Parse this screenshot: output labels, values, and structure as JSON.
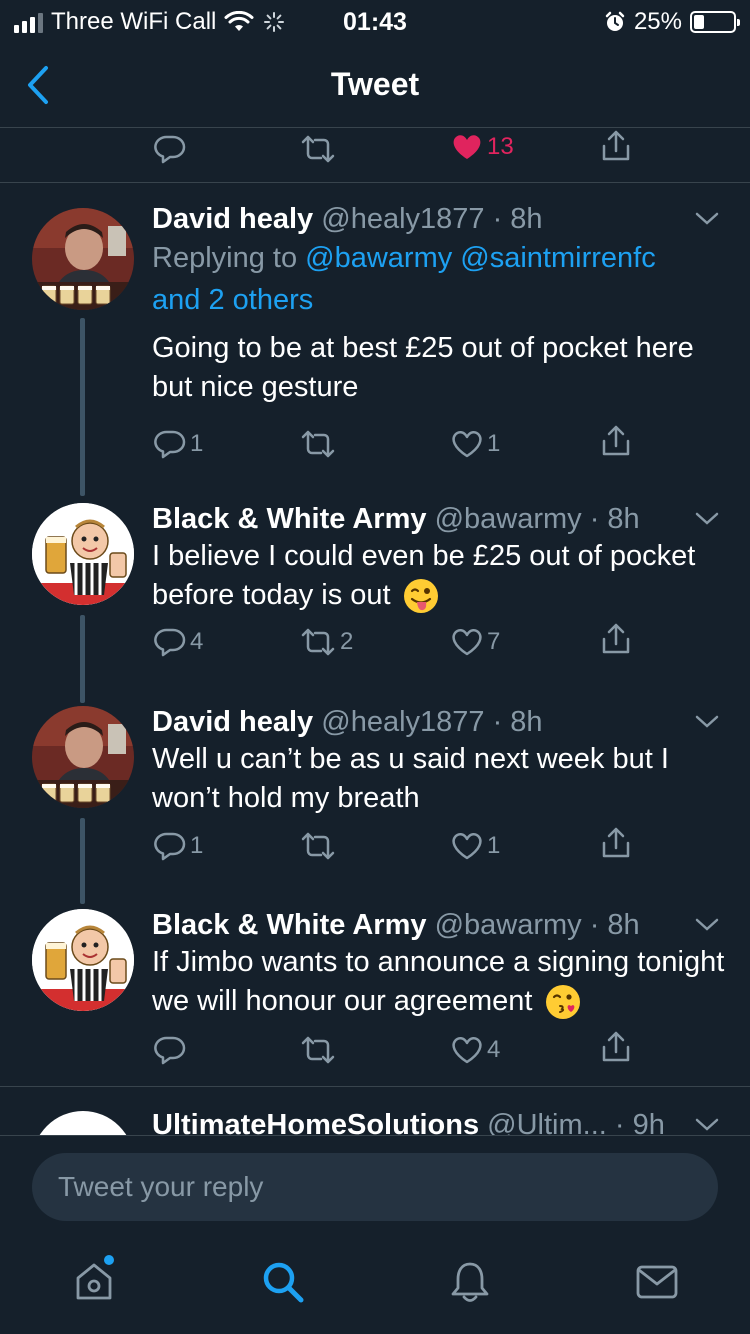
{
  "status_bar": {
    "carrier": "Three WiFi Call",
    "time": "01:43",
    "battery": "25%",
    "battery_level": 0.25
  },
  "nav": {
    "title": "Tweet"
  },
  "top_actions": {
    "likes": "13"
  },
  "tweets": [
    {
      "name": "David healy",
      "handle": "@healy1877 · 8h",
      "replying_prefix": "Replying to ",
      "replying_users": "@bawarmy @saintmirrenfc",
      "replying_others": "and 2 others",
      "text": "Going to be at best £25 out of pocket here but nice gesture",
      "replies": "1",
      "retweets": "",
      "likes": "1"
    },
    {
      "name": "Black & White Army",
      "handle": "@bawarmy · 8h",
      "text": "I believe I could even be £25 out of pocket before today is out",
      "emoji": "winking-tongue-emoji",
      "replies": "4",
      "retweets": "2",
      "likes": "7"
    },
    {
      "name": "David healy",
      "handle": "@healy1877 · 8h",
      "text": "Well u can’t be as u said next week but I won’t hold my breath",
      "replies": "1",
      "retweets": "",
      "likes": "1"
    },
    {
      "name": "Black & White Army",
      "handle": "@bawarmy · 8h",
      "text": "If Jimbo wants to announce a signing tonight we will honour our agreement",
      "emoji": "kissing-face-emoji",
      "replies": "",
      "retweets": "",
      "likes": "4"
    },
    {
      "name": "UltimateHomeSolutions",
      "handle": "@Ultim... · 9h"
    }
  ],
  "reply_bar": {
    "placeholder": "Tweet your reply"
  },
  "tabs": [
    "home-icon",
    "search-icon",
    "notifications-icon",
    "messages-icon"
  ],
  "colors": {
    "background": "#15202b",
    "accent": "#1da1f2",
    "like": "#e0245e",
    "secondary_text": "#8899a6"
  }
}
